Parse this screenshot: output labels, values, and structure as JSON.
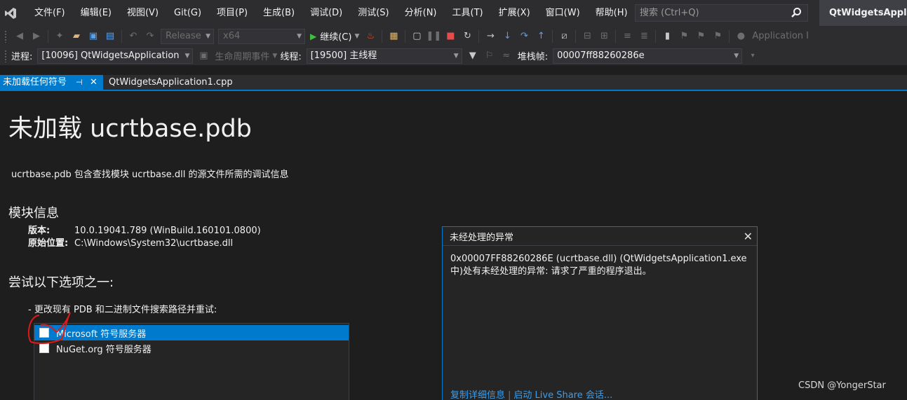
{
  "menubar": {
    "items": [
      "文件(F)",
      "编辑(E)",
      "视图(V)",
      "Git(G)",
      "项目(P)",
      "生成(B)",
      "调试(D)",
      "测试(S)",
      "分析(N)",
      "工具(T)",
      "扩展(X)",
      "窗口(W)",
      "帮助(H)"
    ],
    "search_placeholder": "搜索 (Ctrl+Q)",
    "solution_name": "QtWidgetsApplic"
  },
  "toolbar": {
    "configuration": "Release",
    "platform": "x64",
    "continue_label": "继续(C)",
    "app_insights": "Application I"
  },
  "debug_location": {
    "process_label": "进程:",
    "process_value": "[10096] QtWidgetsApplication",
    "lifecycle_label": "生命周期事件",
    "thread_label": "线程:",
    "thread_value": "[19500] 主线程",
    "stackframe_label": "堆栈帧:",
    "stackframe_value": "00007ff88260286e"
  },
  "tabs": {
    "active": "未加载任何符号",
    "other": "QtWidgetsApplication1.cpp"
  },
  "document": {
    "title": "未加载 ucrtbase.pdb",
    "description": "ucrtbase.pdb 包含查找模块 ucrtbase.dll 的源文件所需的调试信息",
    "module_heading": "模块信息",
    "version_key": "版本:",
    "version_value": "10.0.19041.789 (WinBuild.160101.0800)",
    "location_key": "原始位置:",
    "location_value": "C:\\Windows\\System32\\ucrtbase.dll",
    "options_heading": "尝试以下选项之一:",
    "option_change_paths": "-  更改现有 PDB 和二进制文件搜索路径并重试:",
    "servers": [
      {
        "label": "Microsoft 符号服务器",
        "selected": true
      },
      {
        "label": "NuGet.org 符号服务器",
        "selected": false
      }
    ]
  },
  "exception_popup": {
    "title": "未经处理的异常",
    "message_line1": "0x00007FF88260286E (ucrtbase.dll) (QtWidgetsApplication1.exe",
    "message_line2": "中)处有未经处理的异常: 请求了严重的程序退出。",
    "link_copy": "复制详细信息",
    "link_liveshare": "启动 Live Share 会话..."
  },
  "watermark": "CSDN @YongerStar",
  "colors": {
    "accent": "#007acc",
    "background": "#1e1e1e",
    "chrome": "#2d2d30",
    "link": "#3e9de8",
    "annotation": "#e01818"
  }
}
